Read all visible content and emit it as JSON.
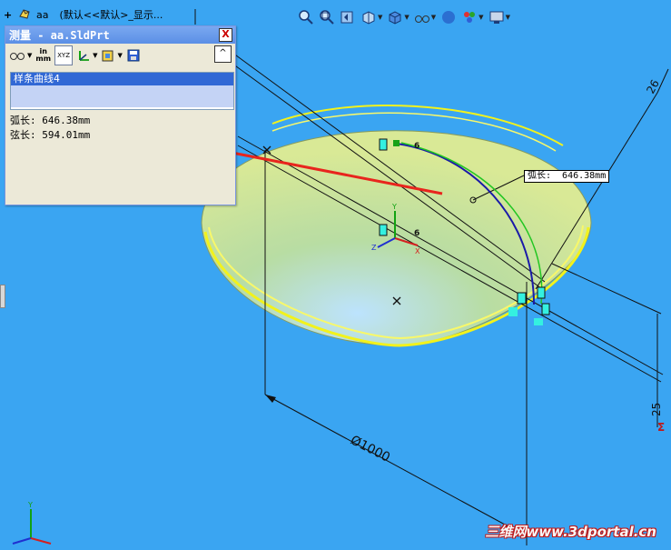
{
  "feature_tree": {
    "expand": "+",
    "part_name": "aa",
    "config_text": "(默认<<默认>_显示..."
  },
  "view_toolbar": {
    "icons": [
      "zoom-to-fit-icon",
      "zoom-to-area-icon",
      "previous-view-icon",
      "section-view-icon",
      "view-orientation-icon",
      "display-style-icon",
      "hide-show-items-icon",
      "edit-appearance-icon",
      "apply-scene-icon",
      "view-settings-icon"
    ]
  },
  "measure_dialog": {
    "title": "测量 - aa.SldPrt",
    "close_label": "X",
    "units_label_top": "in",
    "units_label_bottom": "mm",
    "xyz_label": "XYZ",
    "collapse_label": "^",
    "selection": "样条曲线4",
    "arc_length": "弧长: 646.38mm",
    "chord_length": "弦长: 594.01mm"
  },
  "model_annotations": {
    "arc_callout": "弧长:  646.38mm",
    "diameter_dimension": "Ø1000",
    "dim_26": "26",
    "dim_25": "25",
    "relation_label": "6",
    "axis_x": "X",
    "axis_y": "Y",
    "axis_z": "Z"
  },
  "watermark": "三维网www.3dportal.cn",
  "colors": {
    "background": "#3aa5f2",
    "dome": "#d9e993",
    "arrow": "#e8251d",
    "spline": "#1a1aa8",
    "arc": "#22c622",
    "highlight": "#f2f21c"
  }
}
